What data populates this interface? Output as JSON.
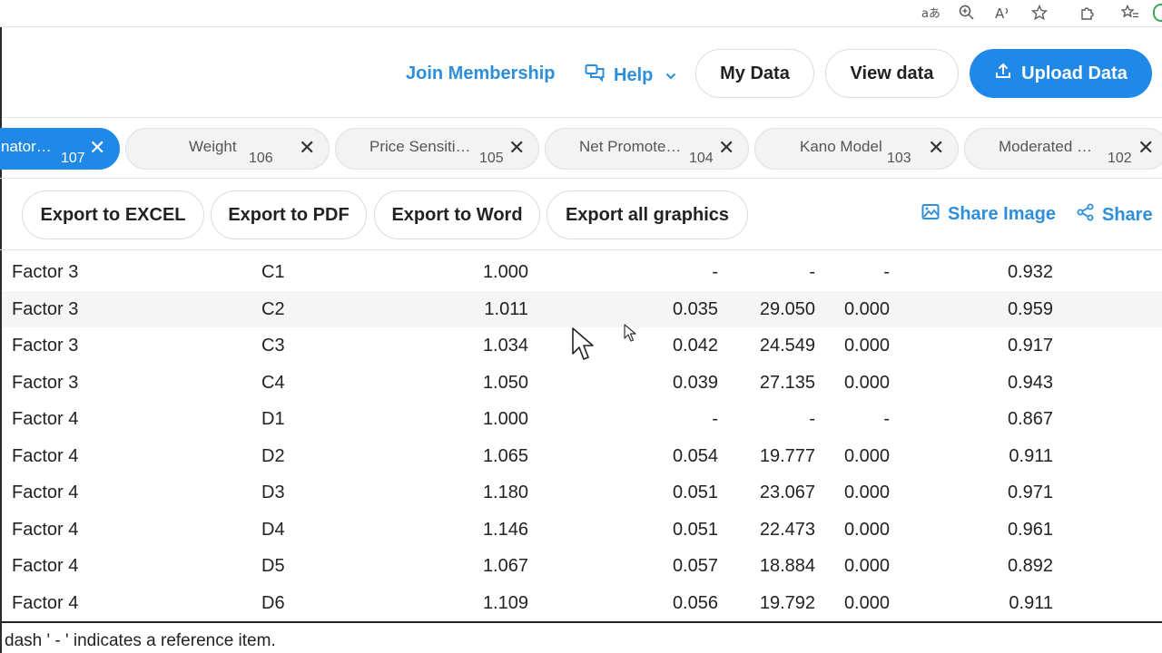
{
  "header": {
    "join_label": "Join Membership",
    "help_label": "Help",
    "my_data_label": "My Data",
    "view_data_label": "View data",
    "upload_label": "Upload Data"
  },
  "tabs": [
    {
      "label": "nator…",
      "count": "107",
      "active": true
    },
    {
      "label": "Weight",
      "count": "106",
      "active": false
    },
    {
      "label": "Price Sensiti…",
      "count": "105",
      "active": false
    },
    {
      "label": "Net Promote…",
      "count": "104",
      "active": false
    },
    {
      "label": "Kano Model",
      "count": "103",
      "active": false
    },
    {
      "label": "Moderated …",
      "count": "102",
      "active": false
    }
  ],
  "exports": {
    "excel": "Export to EXCEL",
    "pdf": "Export to PDF",
    "word": "Export to Word",
    "graphics": "Export all graphics",
    "share_image": "Share Image",
    "share": "Share"
  },
  "table": {
    "rows": [
      [
        "Factor 3",
        "C1",
        "1.000",
        "-",
        "-",
        "-",
        "0.932"
      ],
      [
        "Factor 3",
        "C2",
        "1.011",
        "0.035",
        "29.050",
        "0.000",
        "0.959"
      ],
      [
        "Factor 3",
        "C3",
        "1.034",
        "0.042",
        "24.549",
        "0.000",
        "0.917"
      ],
      [
        "Factor 3",
        "C4",
        "1.050",
        "0.039",
        "27.135",
        "0.000",
        "0.943"
      ],
      [
        "Factor 4",
        "D1",
        "1.000",
        "-",
        "-",
        "-",
        "0.867"
      ],
      [
        "Factor 4",
        "D2",
        "1.065",
        "0.054",
        "19.777",
        "0.000",
        "0.911"
      ],
      [
        "Factor 4",
        "D3",
        "1.180",
        "0.051",
        "23.067",
        "0.000",
        "0.971"
      ],
      [
        "Factor 4",
        "D4",
        "1.146",
        "0.051",
        "22.473",
        "0.000",
        "0.961"
      ],
      [
        "Factor 4",
        "D5",
        "1.067",
        "0.057",
        "18.884",
        "0.000",
        "0.892"
      ],
      [
        "Factor 4",
        "D6",
        "1.109",
        "0.056",
        "19.792",
        "0.000",
        "0.911"
      ]
    ],
    "note": "dash ' - ' indicates a reference item."
  },
  "colors": {
    "accent": "#2088e6",
    "link": "#2d8fdb"
  },
  "browser_icons": [
    "translate-icon",
    "zoom-icon",
    "read-aloud-icon",
    "favorite-star-icon",
    "extensions-icon",
    "favorites-list-icon"
  ]
}
